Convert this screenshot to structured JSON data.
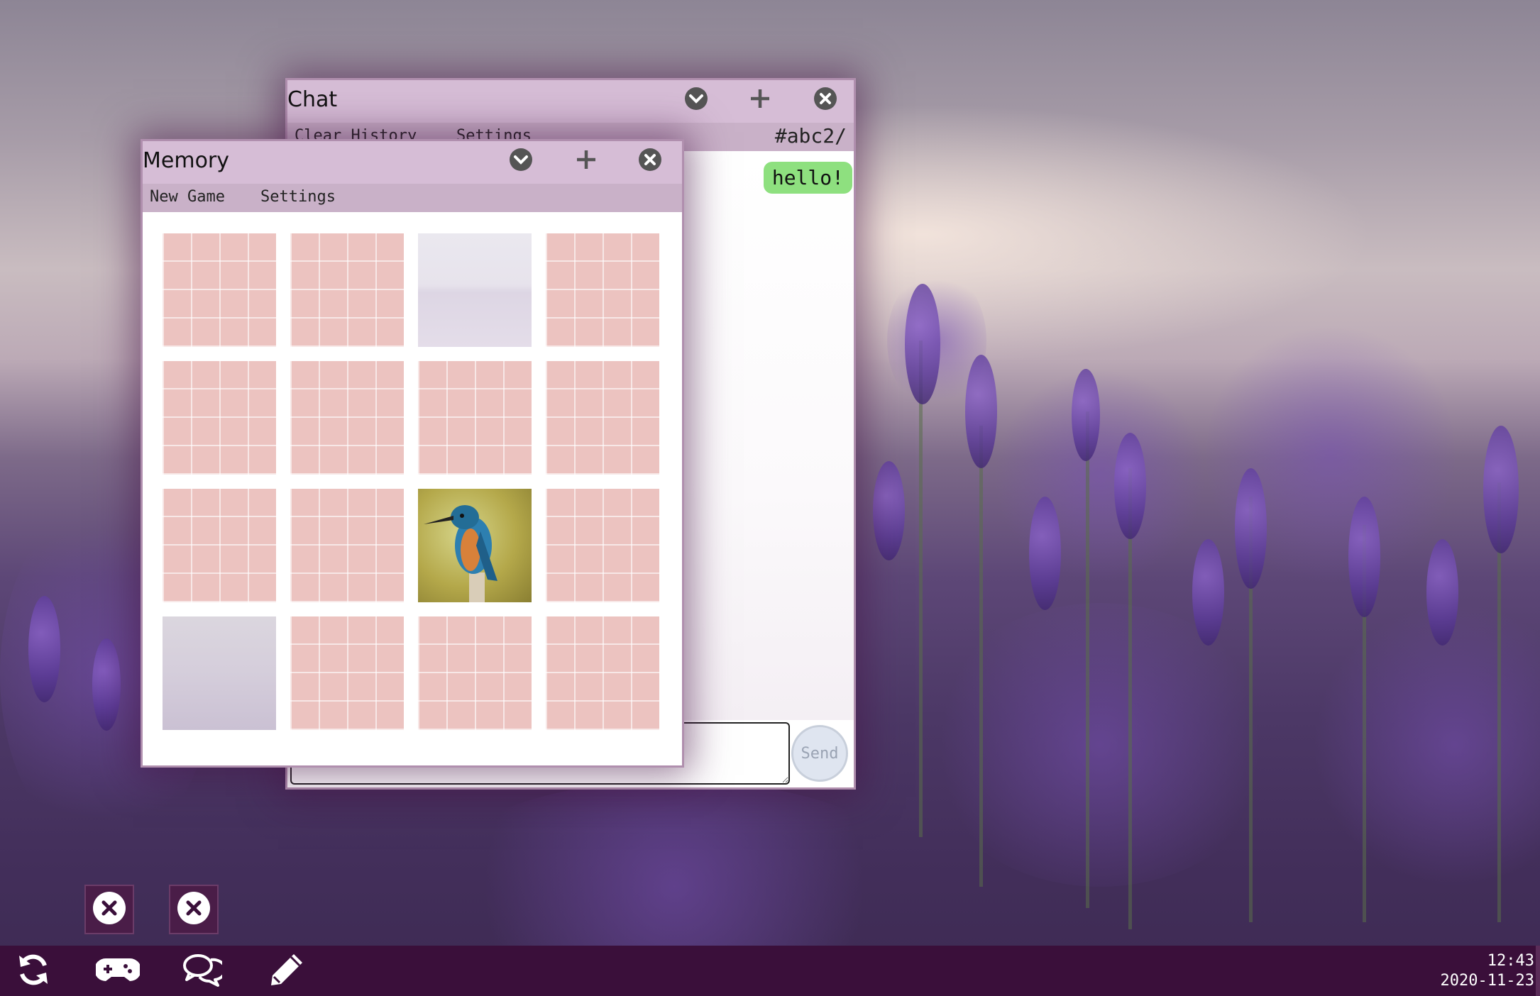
{
  "chat": {
    "title": "Chat",
    "menu": {
      "clear_history": "Clear History",
      "settings": "Settings"
    },
    "room": "#abc2/",
    "messages": [
      {
        "text": "hello!",
        "color": "#8ee07f"
      }
    ],
    "input": {
      "value": "",
      "placeholder": ""
    },
    "send_label": "Send"
  },
  "memory": {
    "title": "Memory",
    "menu": {
      "new_game": "New Game",
      "settings": "Settings"
    },
    "grid": {
      "columns": 4,
      "rows": 4,
      "cards": [
        "back",
        "back",
        "lavender-field",
        "back",
        "back",
        "back",
        "back",
        "back",
        "back",
        "back",
        "kingfisher",
        "back",
        "faded-lavender-field",
        "back",
        "back",
        "back"
      ]
    }
  },
  "window_controls": {
    "minimize_icon": "chevron-down-icon",
    "new_icon": "plus-icon",
    "close_icon": "close-icon"
  },
  "minimized_windows": [
    {
      "icon": "close-icon"
    },
    {
      "icon": "close-icon"
    }
  ],
  "taskbar": {
    "icons": [
      "refresh-icon",
      "gamepad-icon",
      "chat-icon",
      "pencil-icon"
    ],
    "clock": {
      "time": "12:43",
      "date": "2020-11-23"
    }
  },
  "colors": {
    "taskbar": "#3a0f3a",
    "titlebar": "#d6bdd6",
    "menubar": "#c9b1c8",
    "card_back": "#ecc3c0",
    "message_bubble": "#8ee07f"
  }
}
